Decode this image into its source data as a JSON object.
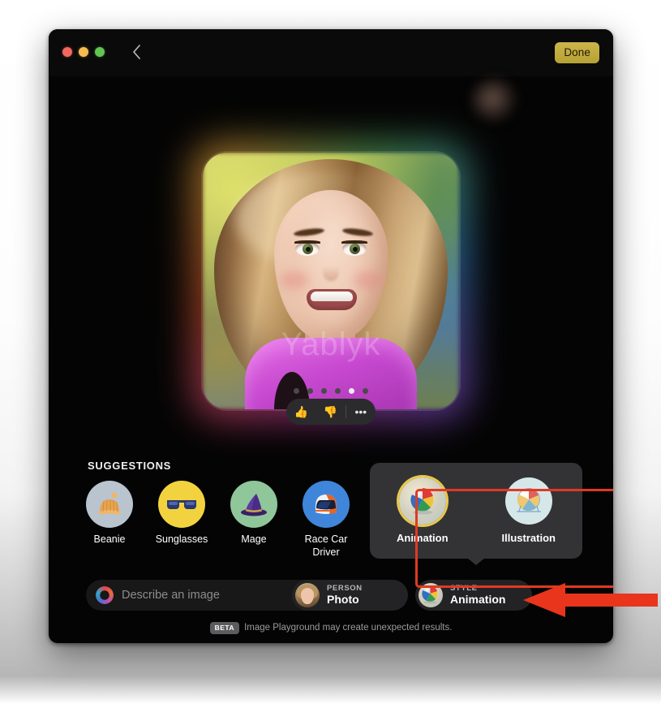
{
  "window": {
    "traffic_lights": [
      "close",
      "minimize",
      "zoom"
    ],
    "back_icon": "chevron-left-icon",
    "done_label": "Done"
  },
  "hero": {
    "watermark": "Yablyk",
    "dots_total": 6,
    "dots_active_index": 4
  },
  "feedback": {
    "thumbs_up": "👍",
    "thumbs_down": "👎",
    "more": "•••"
  },
  "suggestions": {
    "title": "SUGGESTIONS",
    "items": [
      {
        "label": "Beanie",
        "icon": "beanie-icon",
        "bg": "#b9c4cf"
      },
      {
        "label": "Sunglasses",
        "icon": "sunglasses-icon",
        "bg": "#f2d33f"
      },
      {
        "label": "Mage",
        "icon": "wizard-hat-icon",
        "bg": "#8fc79a"
      },
      {
        "label": "Race Car Driver",
        "icon": "racing-helmet-icon",
        "bg": "#3f86db"
      }
    ]
  },
  "style_popover": {
    "options": [
      {
        "label": "Animation",
        "icon": "animation-ball-icon",
        "selected": true
      },
      {
        "label": "Illustration",
        "icon": "illustration-ball-icon",
        "selected": false
      }
    ],
    "selected_ring_color": "#e9c84a"
  },
  "bottom": {
    "describe": {
      "placeholder": "Describe an image",
      "value": "",
      "icon": "prompt-sparkle-icon"
    },
    "person_chip": {
      "kicker": "PERSON",
      "value": "Photo",
      "icon": "person-avatar-icon"
    },
    "style_chip": {
      "kicker": "STYLE",
      "value": "Animation",
      "icon": "animation-ball-icon"
    }
  },
  "footer": {
    "badge": "BETA",
    "text": "Image Playground may create unexpected results."
  },
  "annotations": {
    "highlight_color": "#e03a22",
    "arrow_color": "#e8351c"
  }
}
